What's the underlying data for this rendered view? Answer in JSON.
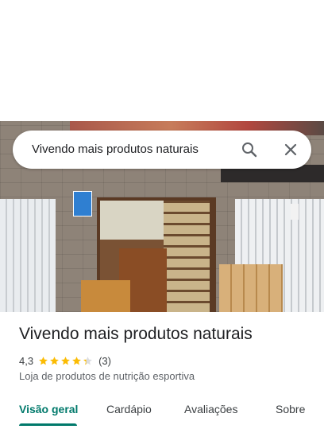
{
  "search": {
    "query": "Vivendo mais produtos naturais"
  },
  "place": {
    "name": "Vivendo mais produtos naturais",
    "rating": "4,3",
    "stars_value": 4.3,
    "review_count": "(3)",
    "category": "Loja de produtos de nutrição esportiva"
  },
  "tabs": [
    {
      "label": "Visão geral",
      "active": true
    },
    {
      "label": "Cardápio",
      "active": false
    },
    {
      "label": "Avaliações",
      "active": false
    },
    {
      "label": "Sobre",
      "active": false
    }
  ],
  "colors": {
    "accent": "#00796b",
    "star": "#fbbc04",
    "star_empty": "#dadce0"
  },
  "icons": [
    "search-icon",
    "close-icon",
    "star-icon"
  ]
}
